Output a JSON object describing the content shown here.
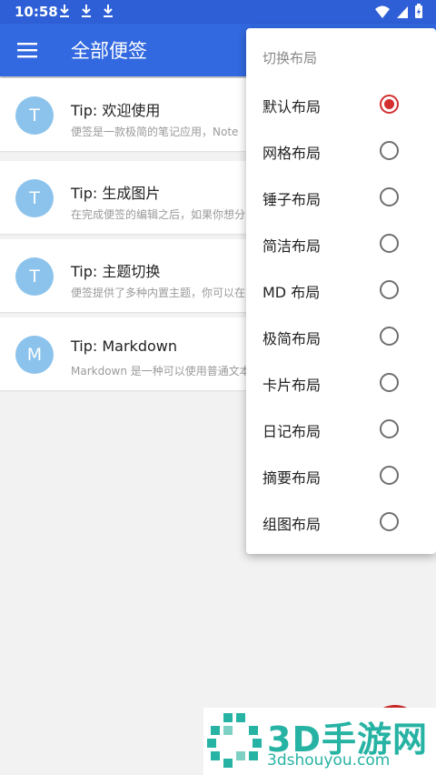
{
  "status_bar": {
    "time": "10:58",
    "icons": [
      "download-icon",
      "download-icon",
      "download-icon",
      "wifi-icon",
      "signal-icon",
      "battery-icon"
    ]
  },
  "app_bar": {
    "title": "全部便签",
    "menu_icon": "menu-icon"
  },
  "notes": [
    {
      "avatar": "T",
      "title": "Tip: 欢迎使用",
      "snippet": "便签是一款极简的笔记应用，Note"
    },
    {
      "avatar": "T",
      "title": "Tip: 生成图片",
      "snippet": "在完成便签的编辑之后，如果你想分"
    },
    {
      "avatar": "T",
      "title": "Tip: 主题切换",
      "snippet": "便签提供了多种内置主题，你可以在"
    },
    {
      "avatar": "M",
      "title": "Tip: Markdown",
      "snippet": "Markdown 是一种可以使用普通文本"
    }
  ],
  "layout_menu": {
    "header": "切换布局",
    "options": [
      {
        "label": "默认布局",
        "selected": true
      },
      {
        "label": "网格布局",
        "selected": false
      },
      {
        "label": "锤子布局",
        "selected": false
      },
      {
        "label": "简洁布局",
        "selected": false
      },
      {
        "label": "MD 布局",
        "selected": false
      },
      {
        "label": "极简布局",
        "selected": false
      },
      {
        "label": "卡片布局",
        "selected": false
      },
      {
        "label": "日记布局",
        "selected": false
      },
      {
        "label": "摘要布局",
        "selected": false
      },
      {
        "label": "组图布局",
        "selected": false
      }
    ]
  },
  "watermark": {
    "name": "3D手游网",
    "url": "3dshouyou.com"
  },
  "colors": {
    "status_bar": "#2f5fd6",
    "app_bar": "#3268e0",
    "avatar": "#8cc3ec",
    "radio_selected": "#d32f2f",
    "watermark": "#27b3a4"
  }
}
